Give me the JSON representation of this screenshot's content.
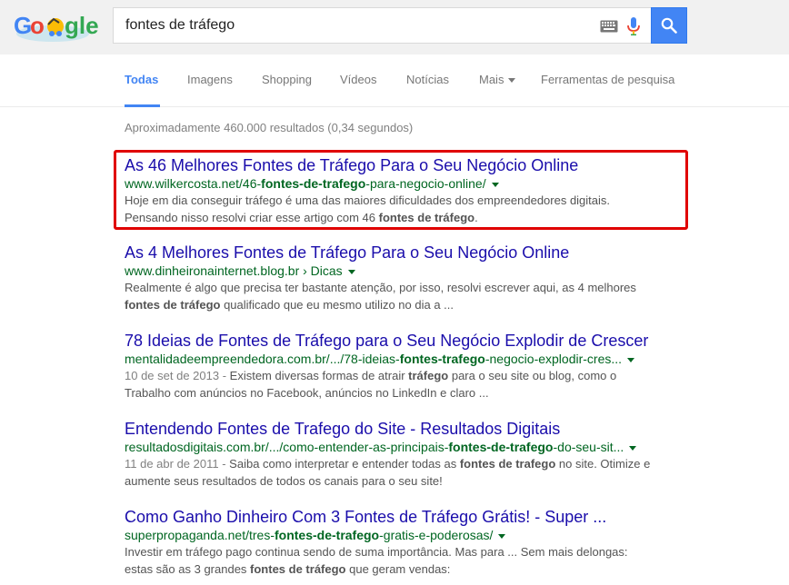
{
  "search": {
    "query": "fontes de tráfego"
  },
  "logo": {
    "letters": [
      "G",
      "o",
      "gle"
    ],
    "colors": {
      "blue": "#4285f4",
      "red": "#ea4335",
      "yellow": "#fbbc05",
      "green": "#34a853"
    }
  },
  "icons": {
    "keyboard": "keyboard-icon",
    "mic": "microphone-icon",
    "search": "search-icon"
  },
  "tabs": [
    {
      "label": "Todas",
      "active": true
    },
    {
      "label": "Imagens"
    },
    {
      "label": "Shopping"
    },
    {
      "label": "Vídeos"
    },
    {
      "label": "Notícias"
    },
    {
      "label": "Mais"
    },
    {
      "label": "Ferramentas de pesquisa"
    }
  ],
  "stats": "Aproximadamente 460.000 resultados (0,34 segundos)",
  "results": [
    {
      "title": "As 46 Melhores Fontes de Tráfego Para o Seu Negócio Online",
      "url_parts": [
        "www.wilkercosta.net/46-",
        "fontes-de-trafego",
        "-para-negocio-online/"
      ],
      "snippet_parts": [
        "Hoje em dia conseguir tráfego é uma das maiores dificuldades dos empreendedores digitais. Pensando nisso resolvi criar esse artigo com 46 ",
        "fontes de tráfego",
        "."
      ]
    },
    {
      "title": "As 4 Melhores Fontes de Tráfego Para o Seu Negócio Online",
      "url_parts": [
        "www.dinheironainternet.blog.br › Dicas"
      ],
      "snippet_parts": [
        "Realmente é algo que precisa ter bastante atenção, por isso, resolvi escrever aqui, as 4 melhores ",
        "fontes de tráfego",
        " qualificado que eu mesmo utilizo no dia a ..."
      ]
    },
    {
      "title": "78 Ideias de Fontes de Tráfego para o Seu Negócio Explodir de Crescer",
      "url_parts": [
        "mentalidadeempreendedora.com.br/.../78-ideias-",
        "fontes-trafego",
        "-negocio-explodir-cres..."
      ],
      "date": "10 de set de 2013 - ",
      "snippet_parts": [
        "Existem diversas formas de atrair ",
        "tráfego",
        " para o seu site ou blog, como o Trabalho com anúncios no Facebook, anúncios no LinkedIn e claro ..."
      ]
    },
    {
      "title": "Entendendo Fontes de Trafego do Site - Resultados Digitais",
      "url_parts": [
        "resultadosdigitais.com.br/.../como-entender-as-principais-",
        "fontes-de-trafego",
        "-do-seu-sit..."
      ],
      "date": "11 de abr de 2011 - ",
      "snippet_parts": [
        "Saiba como interpretar e entender todas as ",
        "fontes de trafego",
        " no site. Otimize e aumente seus resultados de todos os canais para o seu site!"
      ]
    },
    {
      "title": "Como Ganho Dinheiro Com 3 Fontes de Tráfego Grátis! - Super ...",
      "url_parts": [
        "superpropaganda.net/tres-",
        "fontes-de-trafego",
        "-gratis-e-poderosas/"
      ],
      "snippet_parts": [
        "Investir em tráfego pago continua sendo de suma importância. Mas para ... Sem mais delongas: estas são as 3 grandes ",
        "fontes de tráfego",
        " que geram vendas:"
      ]
    }
  ],
  "highlight_color": "#e00000"
}
